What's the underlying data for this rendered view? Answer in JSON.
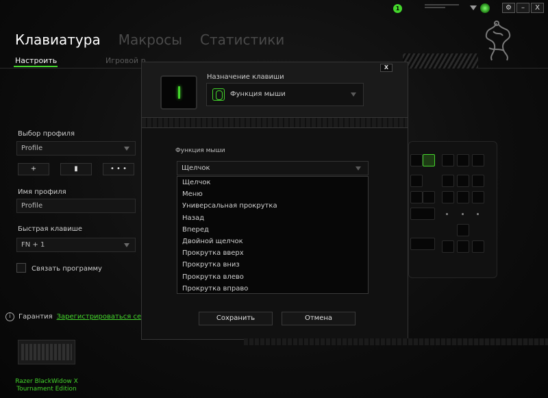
{
  "titlebar": {
    "notification_count": "1",
    "settings_icon": "gear-icon",
    "minimize_label": "–",
    "close_label": "X"
  },
  "header": {
    "tabs": [
      {
        "label": "Клавиатура",
        "active": true
      },
      {
        "label": "Макросы",
        "active": false
      },
      {
        "label": "Статистики",
        "active": false
      }
    ],
    "subtabs": [
      {
        "label": "Настроить",
        "active": true
      },
      {
        "label": "Игровой р",
        "active": false
      }
    ]
  },
  "left_panel": {
    "profile_select_label": "Выбор профиля",
    "profile_select_value": "Profile",
    "add_button": "+",
    "delete_button": "▮",
    "more_button": "• • •",
    "profile_name_label": "Имя профиля",
    "profile_name_value": "Profile",
    "hotkey_label": "Быстрая клавише",
    "hotkey_value": "FN + 1",
    "link_program_label": "Связать программу"
  },
  "footer": {
    "warranty_label": "Гарантия",
    "register_link": "Зарегистрироваться сейч",
    "device_name": "Razer BlackWidow X Tournament Edition"
  },
  "dialog": {
    "close_label": "X",
    "title": "Назначение клавиши",
    "assignment_value": "Функция мыши",
    "mouse_function_label": "Функция мыши",
    "mouse_function_value": "Щелчок",
    "options": [
      "Щелчок",
      "Меню",
      "Универсальная прокрутка",
      "Назад",
      "Вперед",
      "Двойной щелчок",
      "Прокрутка вверх",
      "Прокрутка вниз",
      "Прокрутка влево",
      "Прокрутка вправо"
    ],
    "save_button": "Сохранить",
    "cancel_button": "Отмена"
  },
  "colors": {
    "accent": "#44d62c",
    "background": "#0b0b0b"
  }
}
